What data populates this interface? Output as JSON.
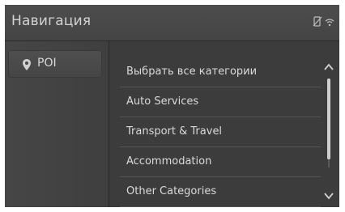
{
  "header": {
    "title": "Навигация",
    "status_icons": [
      "phone-off-icon",
      "wifi-icon"
    ]
  },
  "sidebar": {
    "items": [
      {
        "label": "POI",
        "icon": "location-pin-icon"
      }
    ]
  },
  "list": {
    "items": [
      {
        "label": "Выбрать все категории"
      },
      {
        "label": "Auto Services"
      },
      {
        "label": "Transport & Travel"
      },
      {
        "label": "Accommodation"
      },
      {
        "label": "Other Categories"
      }
    ]
  },
  "colors": {
    "background": "#3c3c3c",
    "text": "#dadada",
    "divider": "#555555"
  }
}
